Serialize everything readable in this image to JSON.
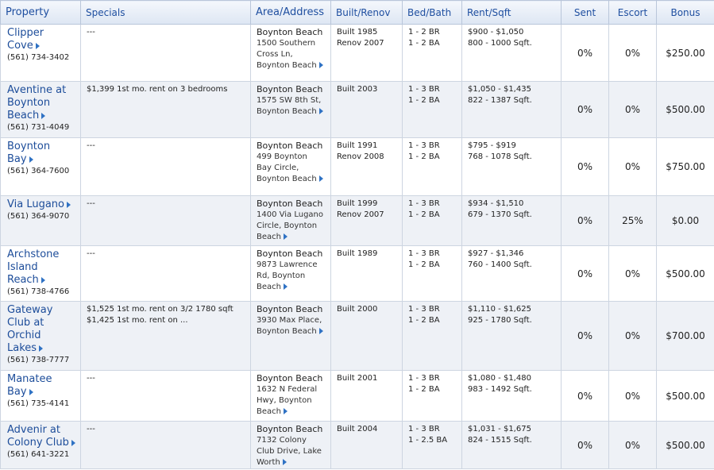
{
  "headers": {
    "property": "Property",
    "specials": "Specials",
    "area": "Area/Address",
    "built": "Built/Renov",
    "bedbath": "Bed/Bath",
    "rent": "Rent/Sqft",
    "sent": "Sent",
    "escort": "Escort",
    "bonus": "Bonus"
  },
  "rows": [
    {
      "name_lines": [
        "Clipper",
        "Cove"
      ],
      "phone": "(561) 734-3402",
      "specials": "---",
      "city": "Boynton Beach",
      "street_lines": [
        "1500 Southern",
        "Cross Ln,",
        "Boynton Beach"
      ],
      "built": "Built 1985",
      "renov": "Renov 2007",
      "bed": "1 - 2 BR",
      "bath": "1 - 2 BA",
      "rent": "$900 - $1,050",
      "sqft": "800 - 1000 Sqft.",
      "sent": "0%",
      "escort": "0%",
      "bonus": "$250.00"
    },
    {
      "name_lines": [
        "Aventine at",
        "Boynton",
        "Beach"
      ],
      "phone": "(561) 731-4049",
      "specials": "$1,399 1st mo. rent on 3 bedrooms",
      "city": "Boynton Beach",
      "street_lines": [
        "1575 SW 8th St,",
        "Boynton Beach"
      ],
      "built": "Built 2003",
      "renov": "",
      "bed": "1 - 3 BR",
      "bath": "1 - 2 BA",
      "rent": "$1,050 - $1,435",
      "sqft": "822 - 1387 Sqft.",
      "sent": "0%",
      "escort": "0%",
      "bonus": "$500.00"
    },
    {
      "name_lines": [
        "Boynton",
        "Bay"
      ],
      "phone": "(561) 364-7600",
      "specials": "---",
      "city": "Boynton Beach",
      "street_lines": [
        "499 Boynton",
        "Bay Circle,",
        "Boynton Beach"
      ],
      "built": "Built 1991",
      "renov": "Renov 2008",
      "bed": "1 - 3 BR",
      "bath": "1 - 2 BA",
      "rent": "$795 - $919",
      "sqft": "768 - 1078 Sqft.",
      "sent": "0%",
      "escort": "0%",
      "bonus": "$750.00"
    },
    {
      "name_lines": [
        "Via Lugano"
      ],
      "phone": "(561) 364-9070",
      "specials": "---",
      "city": "Boynton Beach",
      "street_lines": [
        "1400 Via Lugano",
        "Circle, Boynton",
        "Beach"
      ],
      "built": "Built 1999",
      "renov": "Renov 2007",
      "bed": "1 - 3 BR",
      "bath": "1 - 2 BA",
      "rent": "$934 - $1,510",
      "sqft": "679 - 1370 Sqft.",
      "sent": "0%",
      "escort": "25%",
      "bonus": "$0.00"
    },
    {
      "name_lines": [
        "Archstone",
        "Island",
        "Reach"
      ],
      "phone": "(561) 738-4766",
      "specials": "---",
      "city": "Boynton Beach",
      "street_lines": [
        "9873 Lawrence",
        "Rd, Boynton",
        "Beach"
      ],
      "built": "Built 1989",
      "renov": "",
      "bed": "1 - 3 BR",
      "bath": "1 - 2 BA",
      "rent": "$927 - $1,346",
      "sqft": "760 - 1400 Sqft.",
      "sent": "0%",
      "escort": "0%",
      "bonus": "$500.00"
    },
    {
      "name_lines": [
        "Gateway",
        "Club at",
        "Orchid",
        "Lakes"
      ],
      "phone": "(561) 738-7777",
      "specials": "$1,525 1st mo. rent on 3/2 1780 sqft $1,425 1st mo. rent on ...",
      "city": "Boynton Beach",
      "street_lines": [
        "3930 Max Place,",
        "Boynton Beach"
      ],
      "built": "Built 2000",
      "renov": "",
      "bed": "1 - 3 BR",
      "bath": "1 - 2 BA",
      "rent": "$1,110 - $1,625",
      "sqft": "925 - 1780 Sqft.",
      "sent": "0%",
      "escort": "0%",
      "bonus": "$700.00"
    },
    {
      "name_lines": [
        "Manatee",
        "Bay"
      ],
      "phone": "(561) 735-4141",
      "specials": "---",
      "city": "Boynton Beach",
      "street_lines": [
        "1632 N Federal",
        "Hwy, Boynton",
        "Beach"
      ],
      "built": "Built 2001",
      "renov": "",
      "bed": "1 - 3 BR",
      "bath": "1 - 2 BA",
      "rent": "$1,080 - $1,480",
      "sqft": "983 - 1492 Sqft.",
      "sent": "0%",
      "escort": "0%",
      "bonus": "$500.00"
    },
    {
      "name_lines": [
        "Advenir at",
        "Colony Club"
      ],
      "phone": "(561) 641-3221",
      "specials": "---",
      "city": "Boynton Beach",
      "street_lines": [
        "7132 Colony",
        "Club Drive, Lake",
        "Worth"
      ],
      "built": "Built 2004",
      "renov": "",
      "bed": "1 - 3 BR",
      "bath": "1 - 2.5 BA",
      "rent": "$1,031 - $1,675",
      "sqft": "824 - 1515 Sqft.",
      "sent": "0%",
      "escort": "0%",
      "bonus": "$500.00"
    }
  ],
  "colors": {
    "link": "#1d4d9a",
    "header_text": "#1f4fa0",
    "alt_row": "#eef1f6",
    "arrow": "#2f72c4"
  },
  "icons": {
    "link_arrow": "right-triangle-icon"
  }
}
